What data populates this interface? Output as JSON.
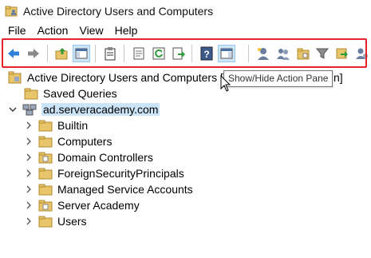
{
  "window": {
    "title": "Active Directory Users and Computers"
  },
  "menu": {
    "items": [
      "File",
      "Action",
      "View",
      "Help"
    ]
  },
  "toolbar": {
    "buttons": [
      {
        "name": "back-button",
        "icon": "back-arrow-icon"
      },
      {
        "name": "forward-button",
        "icon": "forward-arrow-icon"
      },
      {
        "name": "up-one-level-button",
        "icon": "folder-up-icon"
      },
      {
        "name": "show-hide-console-tree-button",
        "icon": "console-tree-icon"
      },
      {
        "name": "copy-button",
        "icon": "clipboard-icon"
      },
      {
        "name": "properties-button",
        "icon": "properties-icon"
      },
      {
        "name": "refresh-button",
        "icon": "refresh-icon"
      },
      {
        "name": "export-list-button",
        "icon": "export-icon"
      },
      {
        "name": "help-button",
        "icon": "help-icon"
      },
      {
        "name": "show-hide-action-pane-button",
        "icon": "action-pane-icon"
      },
      {
        "name": "create-user-button",
        "icon": "new-user-icon"
      },
      {
        "name": "create-group-button",
        "icon": "new-group-icon"
      },
      {
        "name": "create-ou-button",
        "icon": "new-ou-icon"
      },
      {
        "name": "filter-button",
        "icon": "filter-icon"
      },
      {
        "name": "add-to-group-button",
        "icon": "add-to-group-icon"
      },
      {
        "name": "delegate-control-button",
        "icon": "delegate-icon"
      }
    ],
    "tooltip": "Show/Hide Action Pane"
  },
  "tree": {
    "root_label": "Active Directory Users and Computers [sad",
    "root_suffix": "n]",
    "saved_queries": "Saved Queries",
    "domain": "ad.serveracademy.com",
    "children": [
      "Builtin",
      "Computers",
      "Domain Controllers",
      "ForeignSecurityPrincipals",
      "Managed Service Accounts",
      "Server Academy",
      "Users"
    ]
  },
  "colors": {
    "highlight_frame": "#e4222a",
    "selection": "#cce4f7",
    "folder": "#e8c46a"
  }
}
